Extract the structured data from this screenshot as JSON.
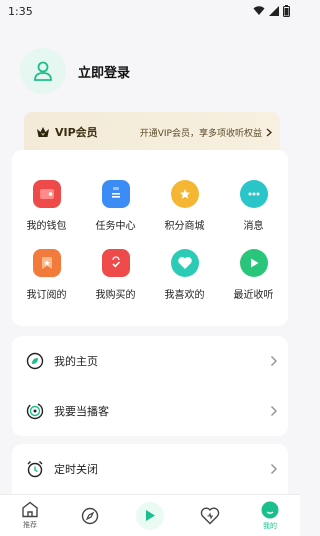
{
  "status_bar": {
    "time": "1:35"
  },
  "profile": {
    "login_label": "立即登录"
  },
  "vip": {
    "title": "VIP会员",
    "description": "开通VIP会员，享多项收听权益"
  },
  "grid": [
    {
      "label": "我的钱包",
      "icon": "wallet-icon",
      "color": "#ee4a4a"
    },
    {
      "label": "任务中心",
      "icon": "task-icon",
      "color": "#3b8df5"
    },
    {
      "label": "积分商城",
      "icon": "points-mall-icon",
      "color": "#f5b733"
    },
    {
      "label": "消息",
      "icon": "message-icon",
      "color": "#29c5c9"
    },
    {
      "label": "我订阅的",
      "icon": "subscription-icon",
      "color": "#f27a3a"
    },
    {
      "label": "我购买的",
      "icon": "purchased-icon",
      "color": "#ee4a4a"
    },
    {
      "label": "我喜欢的",
      "icon": "favorite-icon",
      "color": "#2ccbb6"
    },
    {
      "label": "最近收听",
      "icon": "recent-listen-icon",
      "color": "#29c57a"
    }
  ],
  "list": [
    {
      "label": "我的主页",
      "icon": "homepage-icon"
    },
    {
      "label": "我要当播客",
      "icon": "podcast-icon"
    },
    {
      "label": "定时关闭",
      "icon": "alarm-icon"
    }
  ],
  "tabs": [
    {
      "label": "推荐",
      "icon": "home-icon"
    },
    {
      "label": "",
      "icon": "compass-icon"
    },
    {
      "label": "",
      "icon": "play-icon"
    },
    {
      "label": "",
      "icon": "heart-icon"
    },
    {
      "label": "我的",
      "icon": "profile-icon"
    }
  ],
  "colors": {
    "accent": "#1bbf8b"
  }
}
